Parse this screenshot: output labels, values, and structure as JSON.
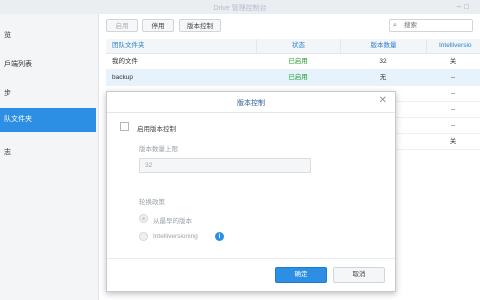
{
  "window": {
    "title": "Drive 管理控制台"
  },
  "sidebar": {
    "items": [
      {
        "label": "览"
      },
      {
        "label": "戶端列表"
      },
      {
        "label": "步"
      },
      {
        "label": "队文件夹"
      },
      {
        "label": "志"
      }
    ],
    "active_index": 3
  },
  "toolbar": {
    "enable_label": "启用",
    "disable_label": "停用",
    "version_label": "版本控制",
    "search_placeholder": "搜索"
  },
  "table": {
    "columns": [
      "团队文件夹",
      "状态",
      "版本数量",
      "Intelliversio"
    ],
    "rows": [
      {
        "name": "我的文件",
        "status": "已启用",
        "versions": "32",
        "intelli": "关"
      },
      {
        "name": "backup",
        "status": "已启用",
        "versions": "无",
        "intelli": "--"
      },
      {
        "name": "",
        "status": "",
        "versions": "",
        "intelli": "--"
      },
      {
        "name": "",
        "status": "",
        "versions": "",
        "intelli": "--"
      },
      {
        "name": "",
        "status": "",
        "versions": "",
        "intelli": "--"
      },
      {
        "name": "",
        "status": "",
        "versions": "",
        "intelli": "关"
      }
    ]
  },
  "dialog": {
    "title": "版本控制",
    "enable_checkbox_label": "启用版本控制",
    "enabled": false,
    "max_versions_label": "版本数量上限",
    "max_versions_value": "32",
    "rotation_label": "轮换政策",
    "option_oldest": "从最早的版本",
    "option_intelli": "Intelliversioning",
    "ok_label": "确定",
    "cancel_label": "取消"
  },
  "colors": {
    "accent": "#2d8fe3",
    "status_green": "#22a02e",
    "header_blue": "#2b7fcf"
  }
}
